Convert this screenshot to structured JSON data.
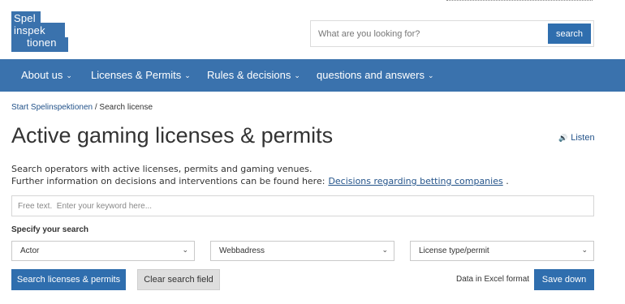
{
  "logo": {
    "line1": "Spel",
    "line2": "inspek",
    "line3": "tionen"
  },
  "search": {
    "placeholder": "What are you looking for?",
    "button_label": "search"
  },
  "nav": {
    "items": [
      {
        "label": "About us"
      },
      {
        "label": "Licenses & Permits"
      },
      {
        "label": "Rules & decisions"
      },
      {
        "label": "questions and answers"
      }
    ]
  },
  "breadcrumb": {
    "home": "Start Spelinspektionen",
    "separator": "/",
    "current": "Search license"
  },
  "page": {
    "title": "Active gaming licenses & permits",
    "listen": "Listen",
    "intro_line1": "Search operators with active licenses, permits and gaming venues.",
    "intro_line2": "Further information on decisions and interventions can be found here:",
    "intro_link": "Decisions regarding betting companies",
    "intro_end": "."
  },
  "filters": {
    "freetext_placeholder": "Free text.  Enter your keyword here...",
    "specify_label": "Specify your search",
    "actor": "Actor",
    "webaddress": "Webbadress",
    "license_type": "License type/permit"
  },
  "actions": {
    "search_button": "Search licenses & permits",
    "clear_button": "Clear search field",
    "excel_label": "Data in Excel format",
    "save_button": "Save down"
  },
  "colors": {
    "brand_blue": "#3a72ad",
    "button_blue": "#2f6eae",
    "link_blue": "#23538a"
  }
}
